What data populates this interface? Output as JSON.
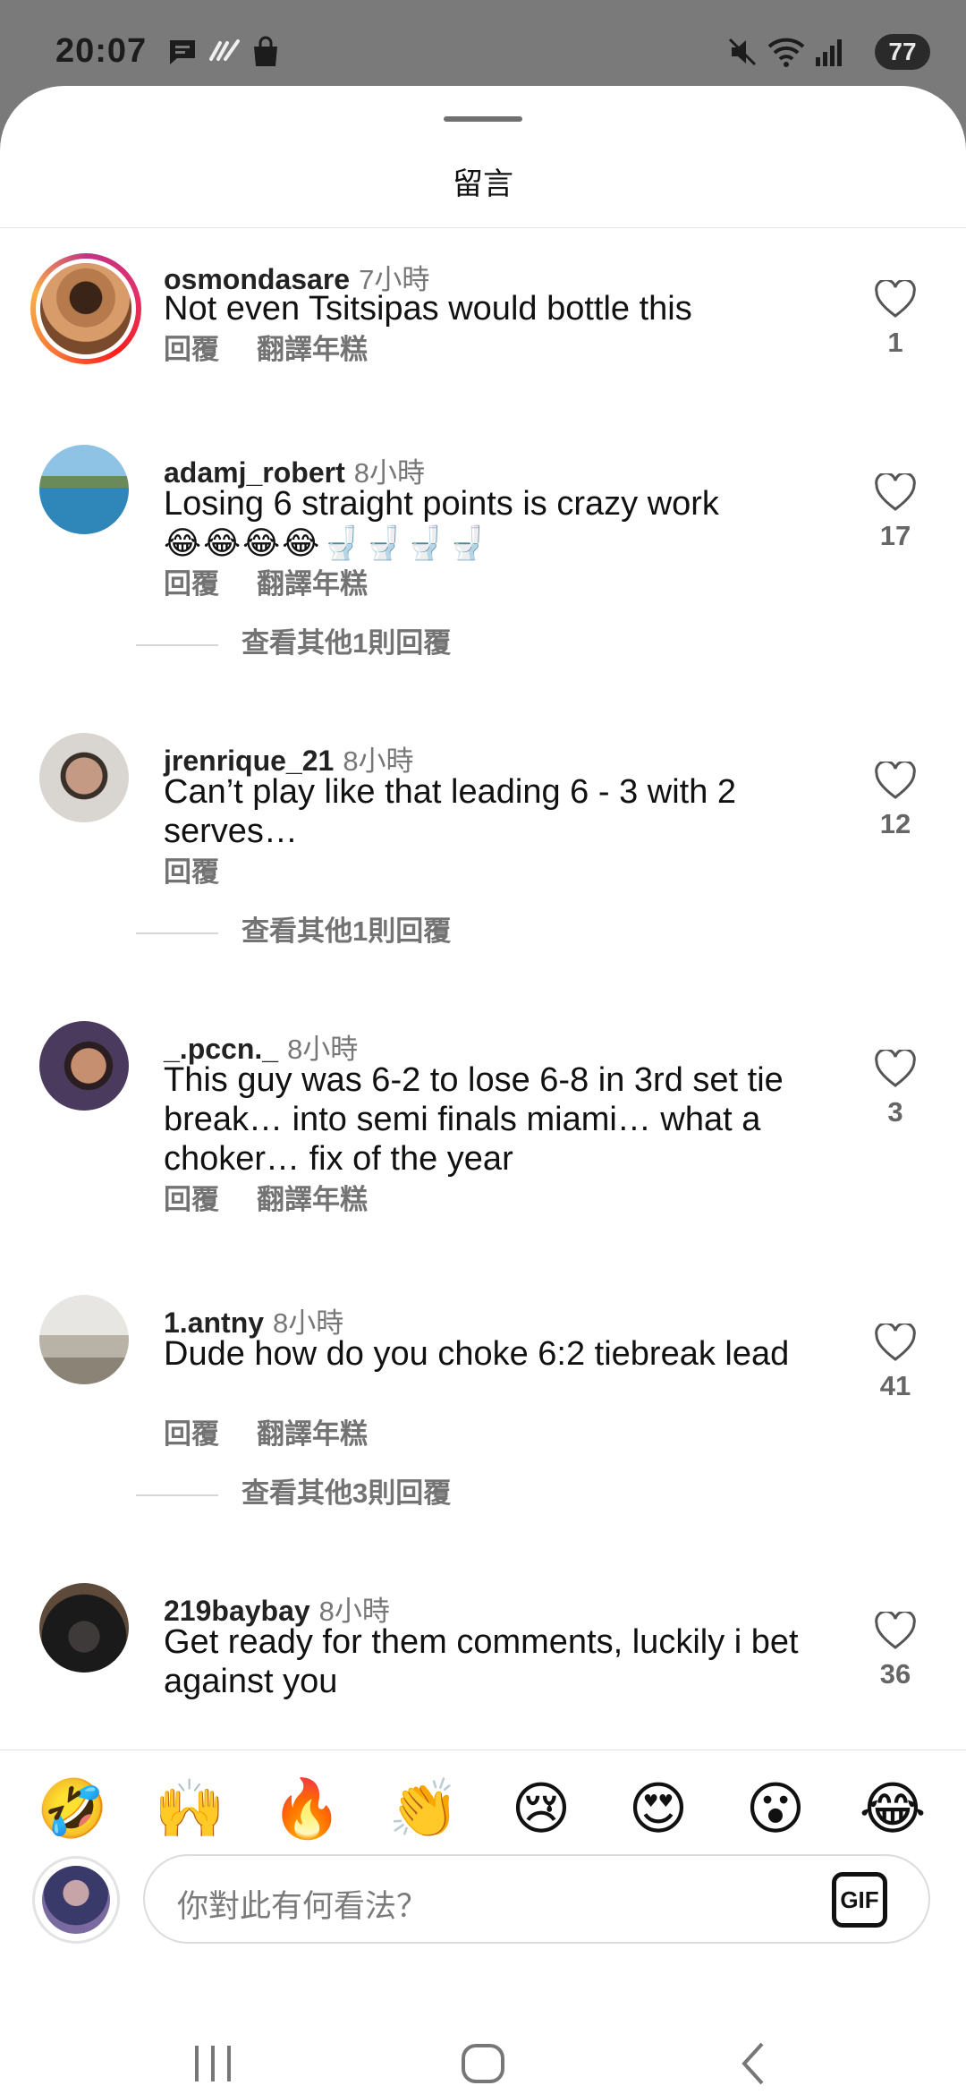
{
  "status_bar": {
    "time": "20:07",
    "battery": "77",
    "icons": [
      "message-icon",
      "app-logo-icon",
      "shopping-bag-icon",
      "mute-icon",
      "wifi-icon",
      "signal-icon",
      "battery-icon"
    ]
  },
  "sheet": {
    "title": "留言"
  },
  "comments": [
    {
      "user": "osmondasare",
      "time": "7小時",
      "text": "Not even Tsitsipas would bottle this",
      "emoji": "",
      "reply": "回覆",
      "translate": "翻譯年糕",
      "likes": "1",
      "avatar_color": "#8a5a3c"
    },
    {
      "user": "adamj_robert",
      "time": "8小時",
      "text": "Losing 6 straight points  is crazy work",
      "emoji": "😂😂😂😂🚽🚽🚽🚽",
      "reply": "回覆",
      "translate": "翻譯年糕",
      "likes": "17",
      "avatar_color": "#3a8fb7"
    },
    {
      "user": "jrenrique_21",
      "time": "8小時",
      "text": "Can’t play like that leading 6 - 3 with 2 serves…",
      "emoji": "",
      "reply": "回覆",
      "translate": "",
      "likes": "12",
      "avatar_color": "#9b8a80"
    },
    {
      "user": "_.pccn._",
      "time": "8小時",
      "text": "This guy was 6-2 to lose 6-8 in 3rd set tie break… into semi finals miami… what a choker… fix of the year",
      "emoji": "",
      "reply": "回覆",
      "translate": "翻譯年糕",
      "likes": "3",
      "avatar_color": "#3c2a4a"
    },
    {
      "user": "1.antny",
      "time": "8小時",
      "text": "Dude how do you choke 6:2 tiebreak lead",
      "emoji": "",
      "reply": "回覆",
      "translate": "翻譯年糕",
      "likes": "41",
      "avatar_color": "#c9c4bc"
    },
    {
      "user": "219baybay",
      "time": "8小時",
      "text": "Get ready for them comments, luckily i bet against you",
      "emoji": "",
      "reply": "",
      "translate": "",
      "likes": "36",
      "avatar_color": "#1e1e1e"
    }
  ],
  "more_replies": [
    "查看其他1則回覆",
    "查看其他1則回覆",
    "查看其他3則回覆"
  ],
  "emoji_bar": [
    "🤣",
    "🙌",
    "🔥",
    "👏",
    "😢",
    "😍",
    "😮",
    "😂"
  ],
  "composer": {
    "placeholder": "你對此有何看法？",
    "gif_label": "GIF",
    "avatar_color": "#3a3a6a"
  },
  "nav": [
    "recent-apps-button",
    "home-button",
    "back-button"
  ]
}
